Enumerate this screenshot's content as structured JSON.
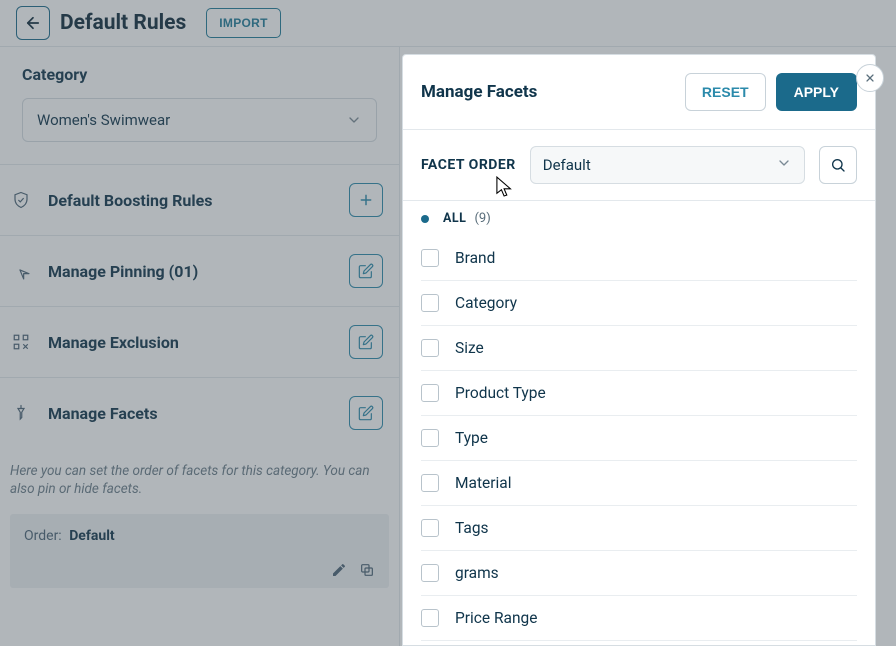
{
  "header": {
    "title": "Default Rules",
    "import_label": "IMPORT"
  },
  "category": {
    "label": "Category",
    "value": "Women's Swimwear"
  },
  "rules": {
    "boosting_label": "Default Boosting Rules",
    "pinning_label": "Manage Pinning (01)",
    "exclusion_label": "Manage Exclusion",
    "facets_label": "Manage Facets"
  },
  "facets_section": {
    "desc": "Here you can set the order of facets for this category. You can also pin or hide facets.",
    "order_key": "Order:",
    "order_value": "Default"
  },
  "panel": {
    "title": "Manage Facets",
    "reset_label": "RESET",
    "apply_label": "APPLY",
    "facet_order_label": "FACET ORDER",
    "facet_order_value": "Default",
    "all_label": "ALL",
    "all_count": "(9)",
    "facets": [
      {
        "name": "Brand"
      },
      {
        "name": "Category"
      },
      {
        "name": "Size"
      },
      {
        "name": "Product Type"
      },
      {
        "name": "Type"
      },
      {
        "name": "Material"
      },
      {
        "name": "Tags"
      },
      {
        "name": "grams"
      },
      {
        "name": "Price Range"
      }
    ]
  }
}
